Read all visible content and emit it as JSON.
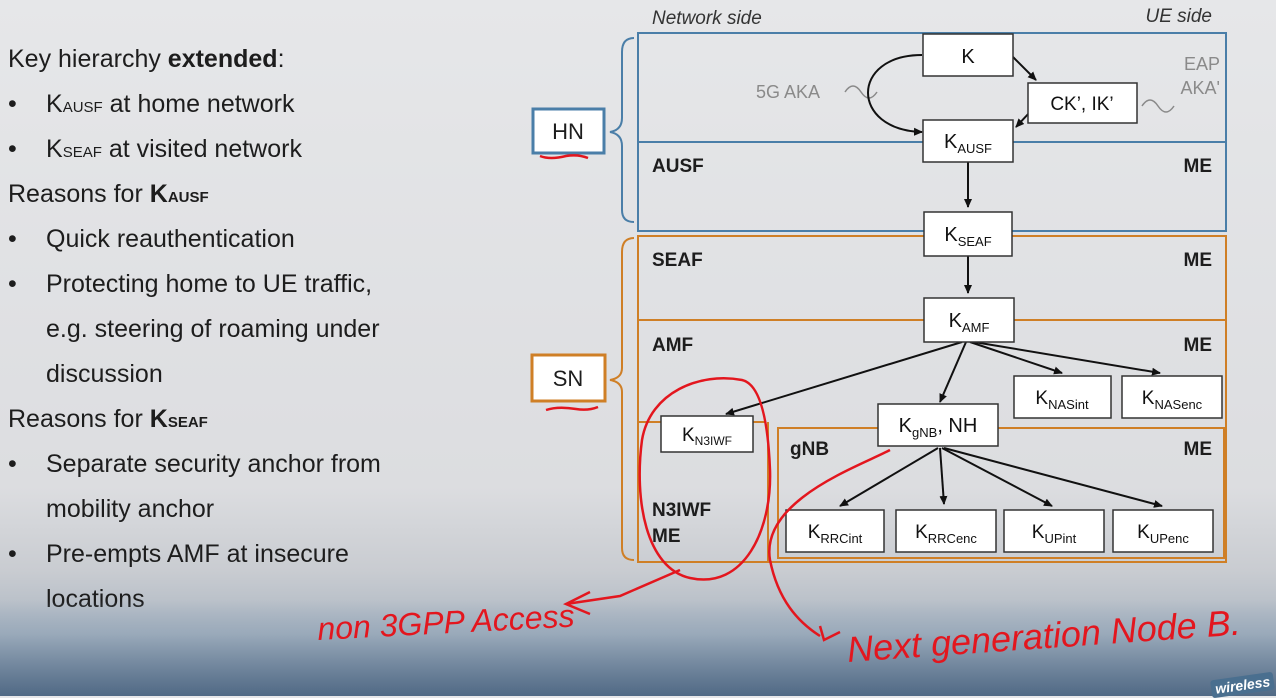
{
  "bullets": {
    "intro_pre": "Key hierarchy ",
    "intro_bold": "extended",
    "intro_post": ":",
    "b1_k": "K",
    "b1_sub": "AUSF",
    "b1_rest": " at home network",
    "b2_k": "K",
    "b2_sub": "SEAF",
    "b2_rest": " at visited network",
    "r1_pre": "Reasons for ",
    "r1_k": "K",
    "r1_sub": "AUSF",
    "r1_items": [
      "Quick reauthentication",
      "Protecting home to UE traffic,",
      "e.g. steering of roaming under",
      "discussion"
    ],
    "r2_pre": "Reasons for ",
    "r2_k": "K",
    "r2_sub": "SEAF",
    "r2_items": [
      "Separate security anchor from",
      "mobility anchor",
      "Pre-empts AMF at insecure",
      "locations"
    ],
    "bullet_char": "•"
  },
  "diagram": {
    "header_left": "Network side",
    "header_right": "UE side",
    "hn_label": "HN",
    "sn_label": "SN",
    "sections": {
      "ausf": "AUSF",
      "seaf": "SEAF",
      "amf": "AMF",
      "gnb": "gNB",
      "n3iwf_1": "N3IWF",
      "n3iwf_2": "ME",
      "me": "ME"
    },
    "eap_1": "EAP",
    "eap_2": "AKA'",
    "aka_5g": "5G AKA",
    "keys": {
      "k": "K",
      "ckik": "CK’, IK’",
      "kausf_sub": "AUSF",
      "kseaf_sub": "SEAF",
      "kamf_sub": "AMF",
      "kn3iwf_sub": "N3IWF",
      "kgnb_sub": "gNB",
      "kgnb_tail": ", NH",
      "knasint_sub": "NASint",
      "knasenc_sub": "NASenc",
      "krrcint_sub": "RRCint",
      "krrcenc_sub": "RRCenc",
      "kupint_sub": "UPint",
      "kupenc_sub": "UPenc"
    },
    "annotations": {
      "n3gpp": "non 3GPP Access",
      "nextgen": "Next generation Node B."
    },
    "colors": {
      "hn_blue": "#4a7ea8",
      "sn_orange": "#cf7f26",
      "ink_red": "#e3161e"
    }
  },
  "watermark": "wireless"
}
